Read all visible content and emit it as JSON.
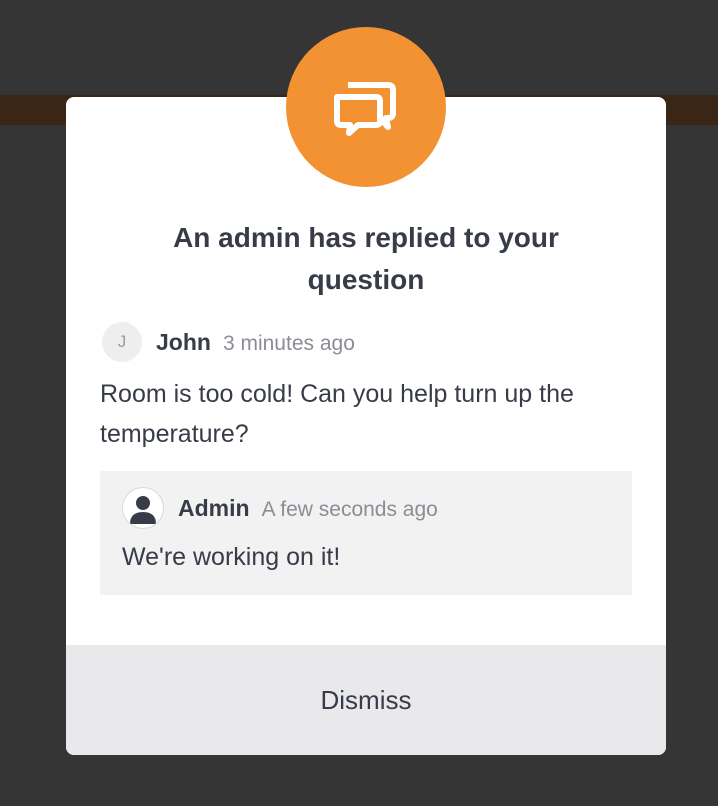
{
  "modal": {
    "title": "An admin has replied to your question",
    "icon": "chat-bubbles-icon",
    "accent_color": "#f29232"
  },
  "question": {
    "author_initial": "J",
    "author_name": "John",
    "timestamp": "3 minutes ago",
    "text": "Room is too cold! Can you help turn up the temperature?"
  },
  "reply": {
    "avatar_icon": "user-silhouette-icon",
    "author_name": "Admin",
    "timestamp": "A few seconds ago",
    "text": "We're working on it!"
  },
  "footer": {
    "dismiss_label": "Dismiss"
  }
}
